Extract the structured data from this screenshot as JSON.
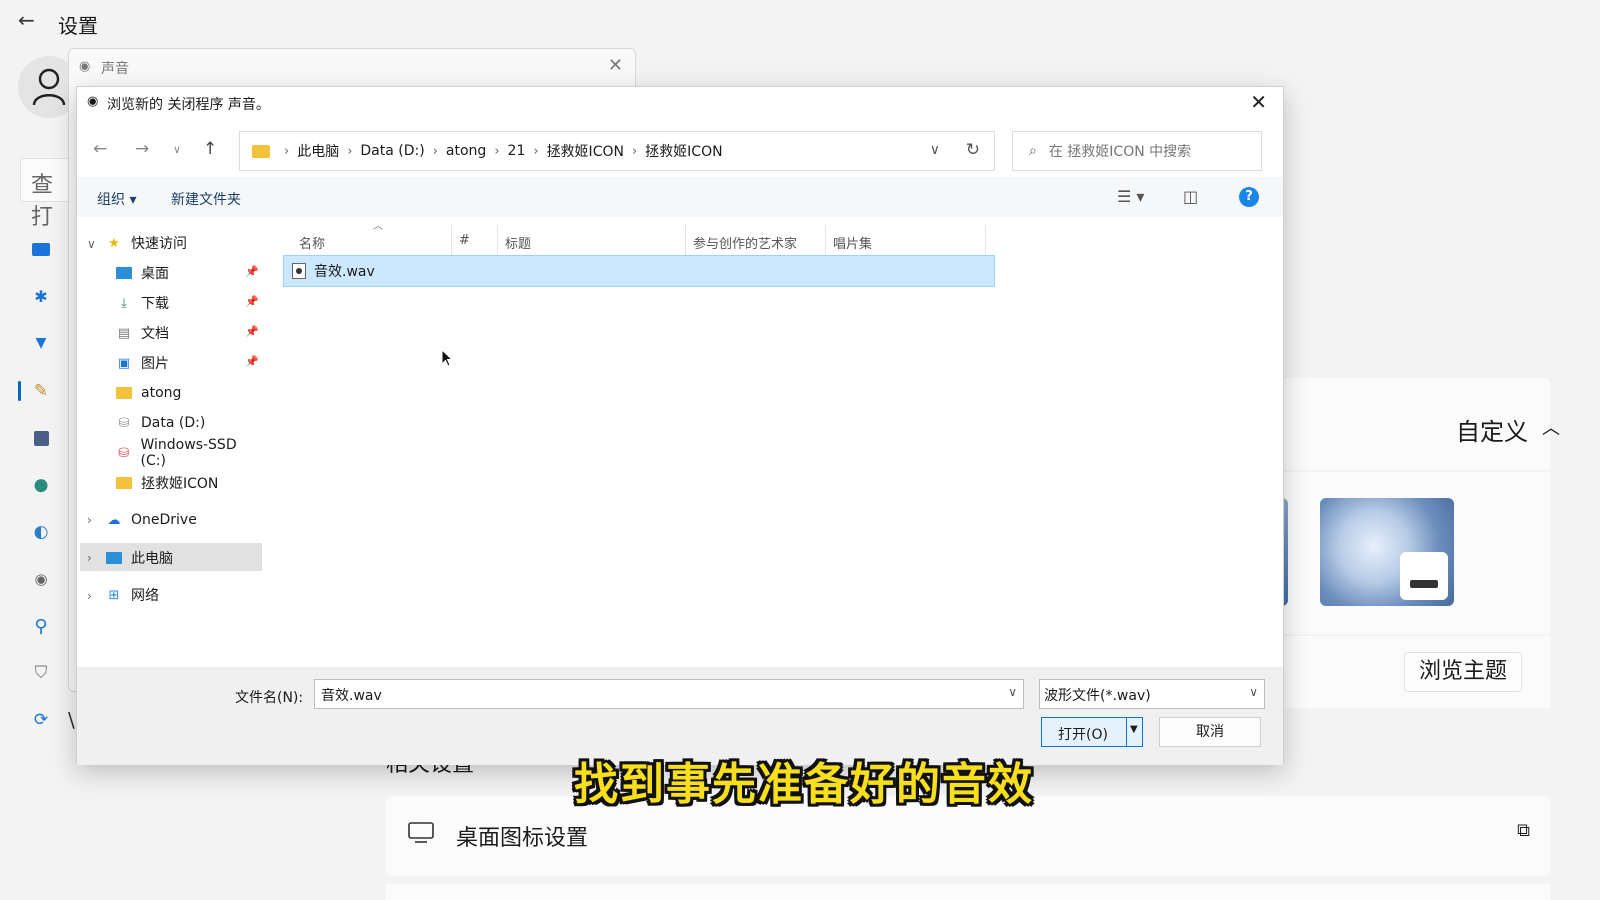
{
  "settings": {
    "title": "设置",
    "search_text": "查打",
    "nav_extra_glyph": "\\",
    "customize_label": "自定义",
    "browse_theme_label": "浏览主题",
    "related_title": "相关设置",
    "desktop_icon_settings": "桌面图标设置"
  },
  "sound_dialog": {
    "title": "声音"
  },
  "file_dialog": {
    "title": "浏览新的 关闭程序 声音。",
    "breadcrumb": [
      "此电脑",
      "Data (D:)",
      "atong",
      "21",
      "拯救姬ICON",
      "拯救姬ICON"
    ],
    "search_placeholder": "在 拯救姬ICON 中搜索",
    "toolbar": {
      "organize": "组织 ▾",
      "new_folder": "新建文件夹"
    },
    "nav": {
      "quick_access": "快速访问",
      "desktop": "桌面",
      "downloads": "下载",
      "documents": "文档",
      "pictures": "图片",
      "atong": "atong",
      "data_d": "Data (D:)",
      "windows_ssd": "Windows-SSD (C:)",
      "icon_folder": "拯救姬ICON",
      "onedrive": "OneDrive",
      "this_pc": "此电脑",
      "network": "网络"
    },
    "columns": [
      "名称",
      "#",
      "标题",
      "参与创作的艺术家",
      "唱片集"
    ],
    "files": [
      {
        "name": "音效.wav"
      }
    ],
    "filename_label": "文件名(N):",
    "filename_value": "音效.wav",
    "filetype": "波形文件(*.wav)",
    "open_label": "打开(O)",
    "cancel_label": "取消"
  },
  "caption": "找到事先准备好的音效",
  "colors": {
    "accent": "#0078d7",
    "selection": "#cce8ff",
    "caption": "#f7df1e"
  }
}
